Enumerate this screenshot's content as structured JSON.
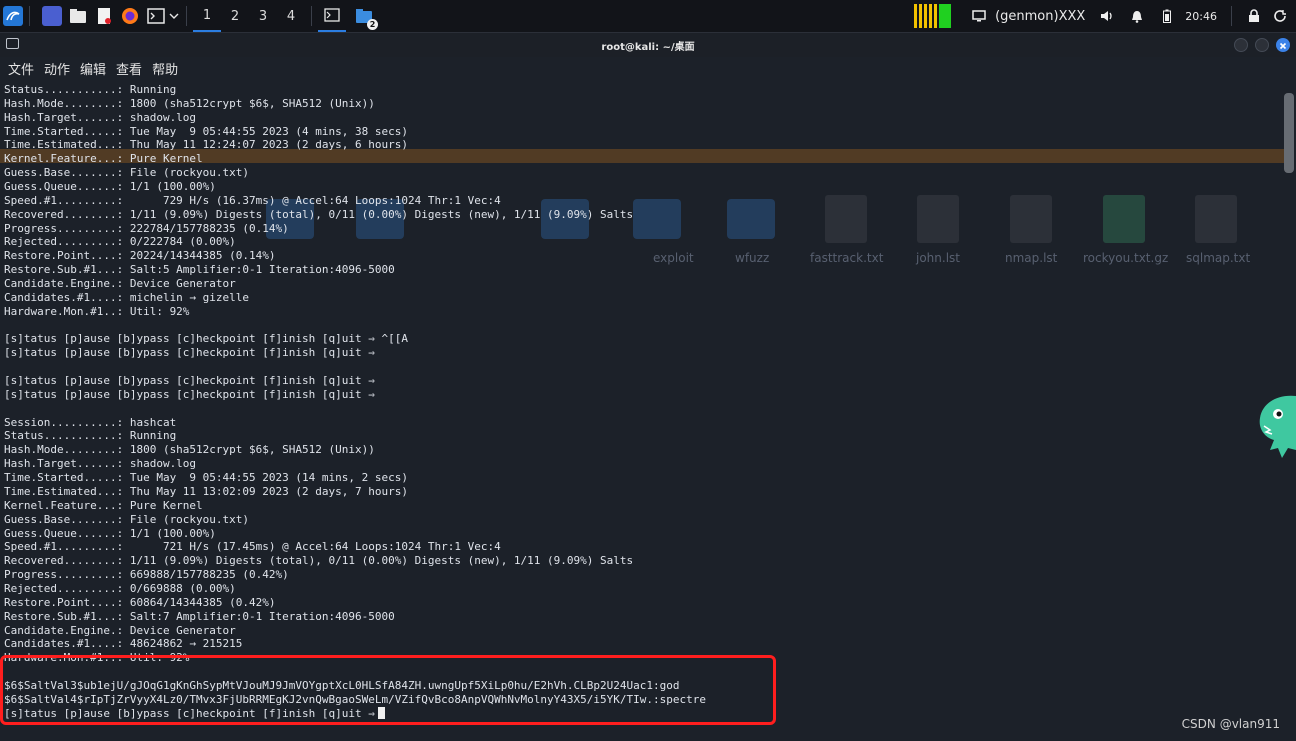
{
  "panel": {
    "workspaces": [
      "1",
      "2",
      "3",
      "4"
    ],
    "task_badge": "2",
    "genmon": "(genmon)XXX",
    "clock": "20:46"
  },
  "window": {
    "title": "root@kali: ~/桌面",
    "menu": [
      "文件",
      "动作",
      "编辑",
      "查看",
      "帮助"
    ]
  },
  "background_files": [
    "exploit",
    "wfuzz",
    "fasttrack.txt",
    "john.lst",
    "nmap.lst",
    "rockyou.txt.gz",
    "sqlmap.txt"
  ],
  "terminal": {
    "lines": [
      "Status...........: Running",
      "Hash.Mode........: 1800 (sha512crypt $6$, SHA512 (Unix))",
      "Hash.Target......: shadow.log",
      "Time.Started.....: Tue May  9 05:44:55 2023 (4 mins, 38 secs)",
      "Time.Estimated...: Thu May 11 12:24:07 2023 (2 days, 6 hours)",
      "Kernel.Feature...: Pure Kernel",
      "Guess.Base.......: File (rockyou.txt)",
      "Guess.Queue......: 1/1 (100.00%)",
      "Speed.#1.........:      729 H/s (16.37ms) @ Accel:64 Loops:1024 Thr:1 Vec:4",
      "Recovered........: 1/11 (9.09%) Digests (total), 0/11 (0.00%) Digests (new), 1/11 (9.09%) Salts",
      "Progress.........: 222784/157788235 (0.14%)",
      "Rejected.........: 0/222784 (0.00%)",
      "Restore.Point....: 20224/14344385 (0.14%)",
      "Restore.Sub.#1...: Salt:5 Amplifier:0-1 Iteration:4096-5000",
      "Candidate.Engine.: Device Generator",
      "Candidates.#1....: michelin → gizelle",
      "Hardware.Mon.#1..: Util: 92%",
      "",
      "[s]tatus [p]ause [b]ypass [c]heckpoint [f]inish [q]uit ⇒ ^[[A",
      "[s]tatus [p]ause [b]ypass [c]heckpoint [f]inish [q]uit ⇒",
      "",
      "[s]tatus [p]ause [b]ypass [c]heckpoint [f]inish [q]uit ⇒",
      "[s]tatus [p]ause [b]ypass [c]heckpoint [f]inish [q]uit ⇒",
      "",
      "Session..........: hashcat",
      "Status...........: Running",
      "Hash.Mode........: 1800 (sha512crypt $6$, SHA512 (Unix))",
      "Hash.Target......: shadow.log",
      "Time.Started.....: Tue May  9 05:44:55 2023 (14 mins, 2 secs)",
      "Time.Estimated...: Thu May 11 13:02:09 2023 (2 days, 7 hours)",
      "Kernel.Feature...: Pure Kernel",
      "Guess.Base.......: File (rockyou.txt)",
      "Guess.Queue......: 1/1 (100.00%)",
      "Speed.#1.........:      721 H/s (17.45ms) @ Accel:64 Loops:1024 Thr:1 Vec:4",
      "Recovered........: 1/11 (9.09%) Digests (total), 0/11 (0.00%) Digests (new), 1/11 (9.09%) Salts",
      "Progress.........: 669888/157788235 (0.42%)",
      "Rejected.........: 0/669888 (0.00%)",
      "Restore.Point....: 60864/14344385 (0.42%)",
      "Restore.Sub.#1...: Salt:7 Amplifier:0-1 Iteration:4096-5000",
      "Candidate.Engine.: Device Generator",
      "Candidates.#1....: 48624862 → 215215",
      "Hardware.Mon.#1..: Util: 92%",
      "",
      "$6$SaltVal3$ub1ejU/gJOqG1gKnGhSypMtVJouMJ9JmVOYgptXcL0HLSfA84ZH.uwngUpf5XiLp0hu/E2hVh.CLBp2U24Uac1:god",
      "$6$SaltVal4$rIpTjZrVyyX4Lz0/TMvx3FjUbRRMEgKJ2vnQwBgaoSWeLm/VZifQvBco8AnpVQWhNvMolnyY43X5/i5YK/TIw.:spectre",
      "[s]tatus [p]ause [b]ypass [c]heckpoint [f]inish [q]uit ⇒"
    ]
  },
  "watermark": "CSDN @vlan911",
  "colors": {
    "highlight_box": "#ff1e1e",
    "accent": "#2b7de1"
  }
}
